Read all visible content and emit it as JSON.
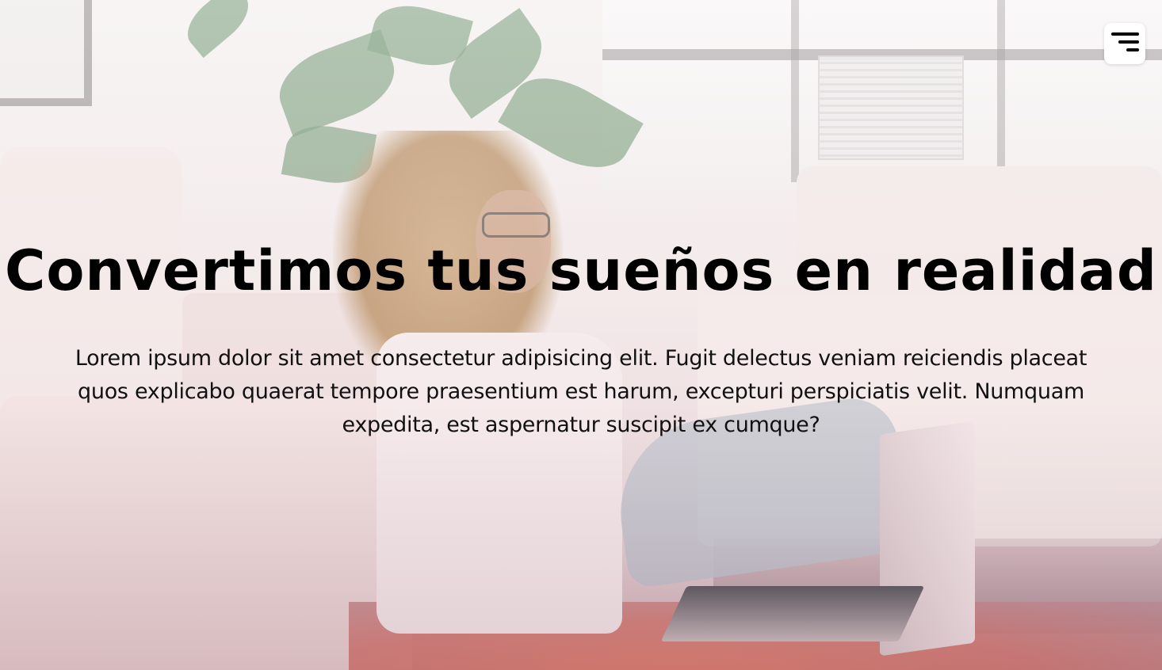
{
  "hero": {
    "title": "Convertimos tus sueños en realidad",
    "description": "Lorem ipsum dolor sit amet consectetur adipisicing elit. Fugit delectus veniam reiciendis placeat quos explicabo quaerat tempore praesentium est harum, excepturi perspiciatis velit. Numquam expedita, est aspernatur suscipit ex cumque?"
  },
  "header": {
    "menu_icon": "menu-icon"
  },
  "colors": {
    "title_text": "#000000",
    "body_text": "#111111",
    "menu_button_bg": "#ffffff"
  }
}
